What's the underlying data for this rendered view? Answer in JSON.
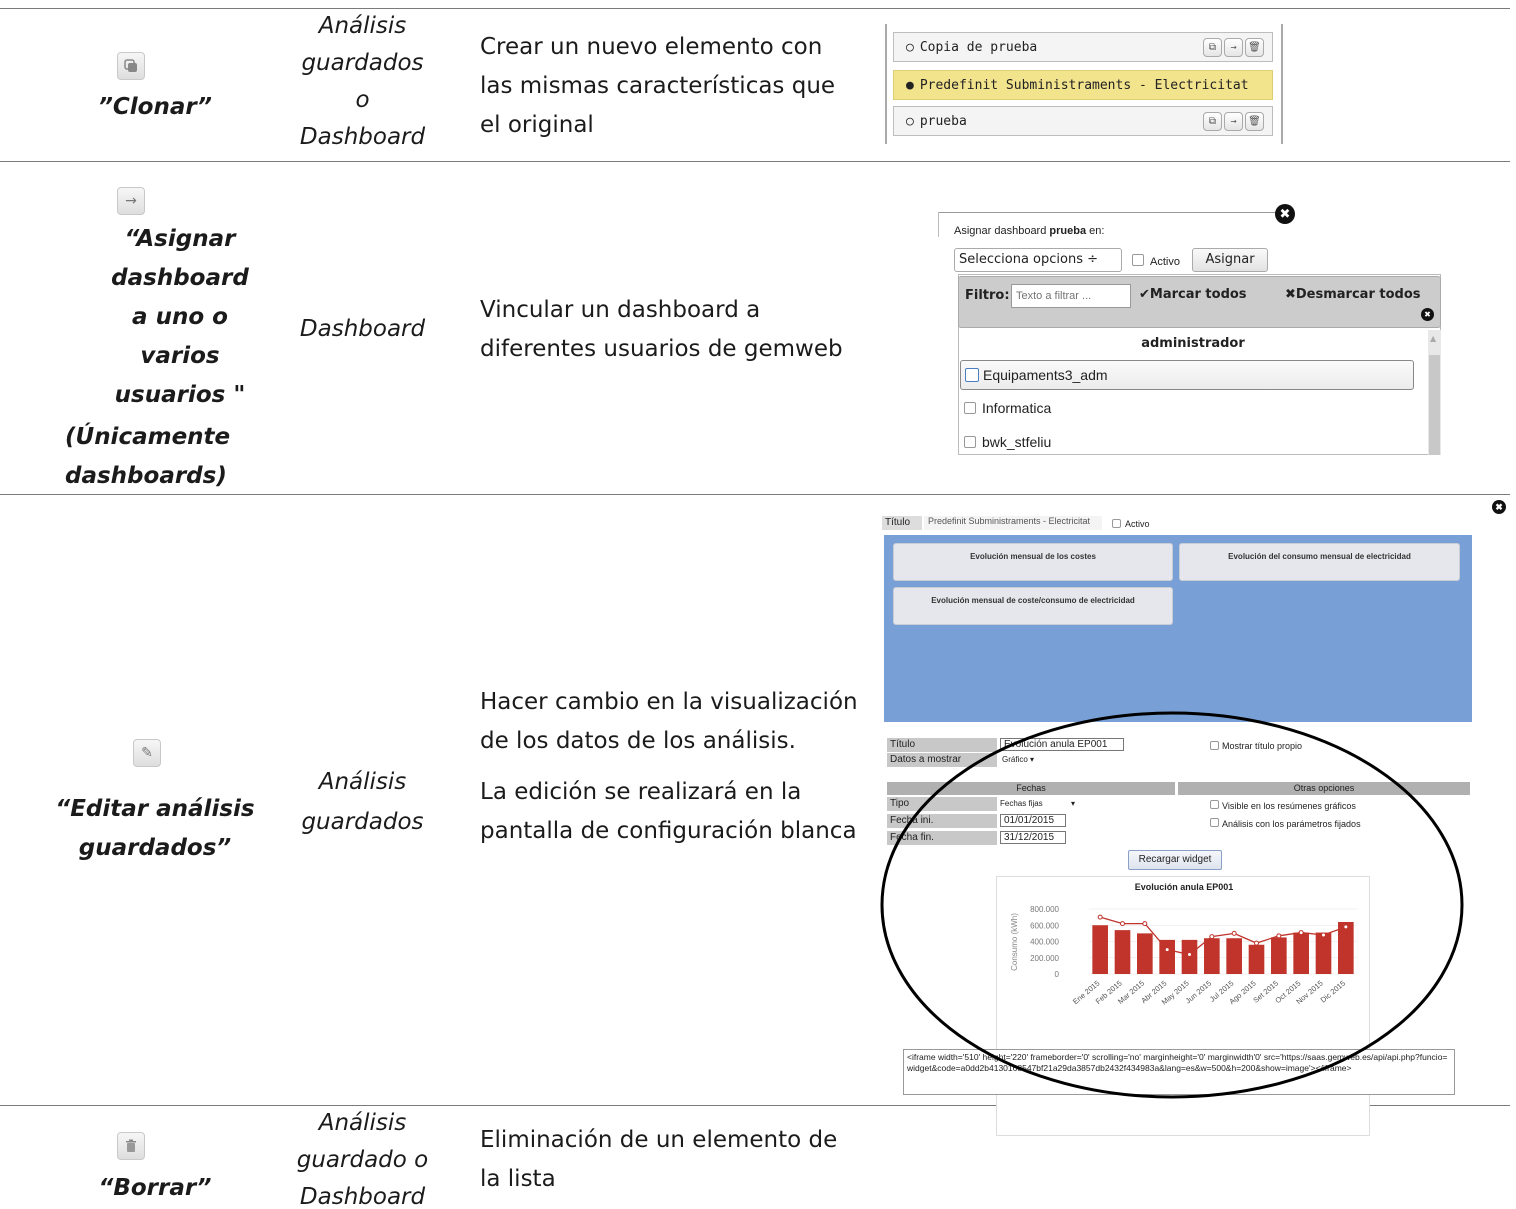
{
  "rows": [
    {
      "action": "”Clonar”",
      "icon": "clone-icon",
      "scope_lines": [
        "Análisis",
        "guardados",
        "o",
        "Dashboard"
      ],
      "description": "Crear un nuevo elemento con las mismas características que el original"
    },
    {
      "action_lines": [
        "“Asignar",
        "dashboard",
        "a uno o",
        "varios",
        "usuarios \"",
        "(Únicamente",
        "dashboards)"
      ],
      "icon": "arrow-right-icon",
      "scope": "Dashboard",
      "description": "Vincular un dashboard a diferentes usuarios de gemweb"
    },
    {
      "action_lines": [
        "“Editar análisis",
        "guardados”"
      ],
      "icon": "pencil-icon",
      "scope_lines": [
        "Análisis",
        "guardados"
      ],
      "description_p1": "Hacer cambio en la visualización de los datos de los análisis.",
      "description_p2": "La edición se realizará en la pantalla de configuración blanca"
    },
    {
      "action": "“Borrar”",
      "icon": "trash-icon",
      "scope_lines": [
        "Análisis",
        "guardado o",
        "Dashboard"
      ],
      "description": "Eliminación de un elemento de la lista"
    }
  ],
  "clone_list": {
    "items": [
      {
        "label": "Copia de prueba",
        "bullet": "○",
        "selected": false
      },
      {
        "label": "Predefinit Subministraments - Electricitat",
        "bullet": "●",
        "selected": true
      },
      {
        "label": "prueba",
        "bullet": "○",
        "selected": false
      }
    ]
  },
  "assign_dialog": {
    "title_prefix": "Asignar dashboard ",
    "title_name": "prueba",
    "title_suffix": " en:",
    "select_value": "Selecciona opcions ÷",
    "active_label": "Activo",
    "assign_button": "Asignar",
    "filter_label": "Filtro:",
    "filter_placeholder": "Texto a filtrar ...",
    "check_all": "✔Marcar todos",
    "uncheck_all": "✖Desmarcar todos",
    "group_header": "administrador",
    "users": [
      "Equipaments3_adm",
      "Informatica",
      "bwk_stfeliu"
    ]
  },
  "edit_screen": {
    "title_label": "Título",
    "title_value": "Predefinit Subministraments - Electricitat",
    "active_label": "Activo",
    "widgets": [
      "Evolución mensual de los costes",
      "Evolución del consumo mensual de electricidad",
      "Evolución mensual de coste/consumo de electricidad"
    ],
    "form": {
      "titulo_label": "Título",
      "titulo_value": "Evolución anula EP001",
      "show_title_label": "Mostrar título propio",
      "datos_label": "Datos a mostrar",
      "datos_value": "Gráfico ▾",
      "fechas_header": "Fechas",
      "otras_header": "Otras opciones",
      "tipo_label": "Tipo",
      "tipo_value": "Fechas fijas",
      "fecha_ini_label": "Fecha ini.",
      "fecha_ini_value": "01/01/2015",
      "fecha_fin_label": "Fecha fin.",
      "fecha_fin_value": "31/12/2015",
      "visible_label": "Visible en los resúmenes gráficos",
      "fixed_label": "Análisis con los parámetros fijados",
      "reload_button": "Recargar widget",
      "iframe_code": "<iframe width='510' height='220' frameborder='0' scrolling='no' marginheight='0' marginwidth'0' src='https://saas.gemweb.es/api/api.php?funcio=widget&code=a0dd2b4130168547bf21a29da3857db2432f434983a&lang=es&w=500&h=200&show=image'></iframe>"
    }
  },
  "chart_data": {
    "type": "bar",
    "title": "Evolución anula EP001",
    "ylabel": "Consumo (kWh)",
    "xlabel": "",
    "ylim": [
      0,
      800000
    ],
    "ytick_labels": [
      "800.000",
      "600.000",
      "400.000",
      "200.000",
      "0"
    ],
    "categories": [
      "Ene 2015",
      "Feb 2015",
      "Mar 2015",
      "Abr 2015",
      "May 2015",
      "Jun 2015",
      "Jul 2015",
      "Ago 2015",
      "Set 2015",
      "Oct 2015",
      "Nov 2015",
      "Dic 2015"
    ],
    "series": [
      {
        "type": "bar",
        "color": "#c0342b",
        "values": [
          600000,
          540000,
          500000,
          420000,
          420000,
          440000,
          440000,
          360000,
          450000,
          510000,
          510000,
          640000
        ]
      },
      {
        "type": "line",
        "color": "#c0342b",
        "values": [
          700000,
          620000,
          620000,
          300000,
          240000,
          460000,
          500000,
          380000,
          470000,
          510000,
          480000,
          580000
        ]
      }
    ],
    "grid": true
  }
}
